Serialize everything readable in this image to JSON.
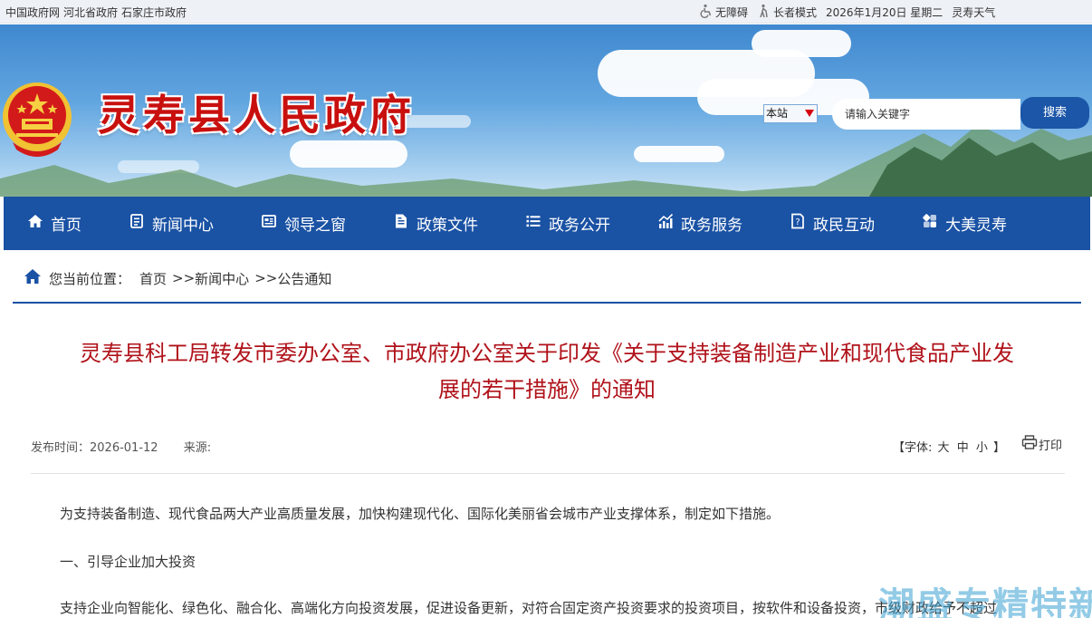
{
  "topbar": {
    "links": [
      "中国政府网",
      "河北省政府",
      "石家庄市政府"
    ],
    "accessibility": "无障碍",
    "elder_mode": "长者模式",
    "date": "2026年1月20日 星期二",
    "weather": "灵寿天气"
  },
  "header": {
    "site_title": "灵寿县人民政府",
    "scope": "本站",
    "search_placeholder": "请输入关键字",
    "search_button": "搜索"
  },
  "nav": {
    "items": [
      {
        "label": "首页",
        "icon": "home-icon"
      },
      {
        "label": "新闻中心",
        "icon": "news-icon"
      },
      {
        "label": "领导之窗",
        "icon": "leader-icon"
      },
      {
        "label": "政策文件",
        "icon": "document-icon"
      },
      {
        "label": "政务公开",
        "icon": "list-icon"
      },
      {
        "label": "政务服务",
        "icon": "chart-icon"
      },
      {
        "label": "政民互动",
        "icon": "interaction-icon"
      },
      {
        "label": "大美灵寿",
        "icon": "scenery-icon"
      }
    ]
  },
  "breadcrumb": {
    "label": "您当前位置：",
    "home": "首页",
    "sep": ">>",
    "level1": "新闻中心",
    "level2": "公告通知"
  },
  "article": {
    "title_line1": "灵寿县科工局转发市委办公室、市政府办公室关于印发《关于支持装备制造产业和现代食品产业发",
    "title_line2": "展的若干措施》的通知",
    "publish_label": "发布时间：",
    "publish_date": "2026-01-12",
    "source_label": "来源:",
    "font_label": "【字体:",
    "font_large": "大",
    "font_medium": "中",
    "font_small": "小",
    "font_close": "】",
    "print": "打印",
    "paragraphs": [
      "为支持装备制造、现代食品两大产业高质量发展，加快构建现代化、国际化美丽省会城市产业支撑体系，制定如下措施。",
      "一、引导企业加大投资",
      "支持企业向智能化、绿色化、融合化、高端化方向投资发展，促进设备更新，对符合固定资产投资要求的投资项目，按软件和设备投资，市级财政给予不超过"
    ]
  },
  "watermark": "潮盛专精特新",
  "colors": {
    "nav_bg": "#1a52a4",
    "title_red": "#b0121a",
    "site_title_red": "#c8100e"
  }
}
